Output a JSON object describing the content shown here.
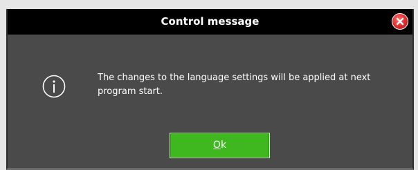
{
  "dialog": {
    "title": "Control message",
    "close_icon": "close-icon",
    "info_icon": "info-icon",
    "message": "The changes to the language settings will be applied at next program start.",
    "ok_mnemonic": "O",
    "ok_rest": "k"
  },
  "colors": {
    "titlebar": "#000000",
    "body": "#4a4a4a",
    "ok_button": "#3fb71f",
    "close_button": "#e0282b"
  }
}
